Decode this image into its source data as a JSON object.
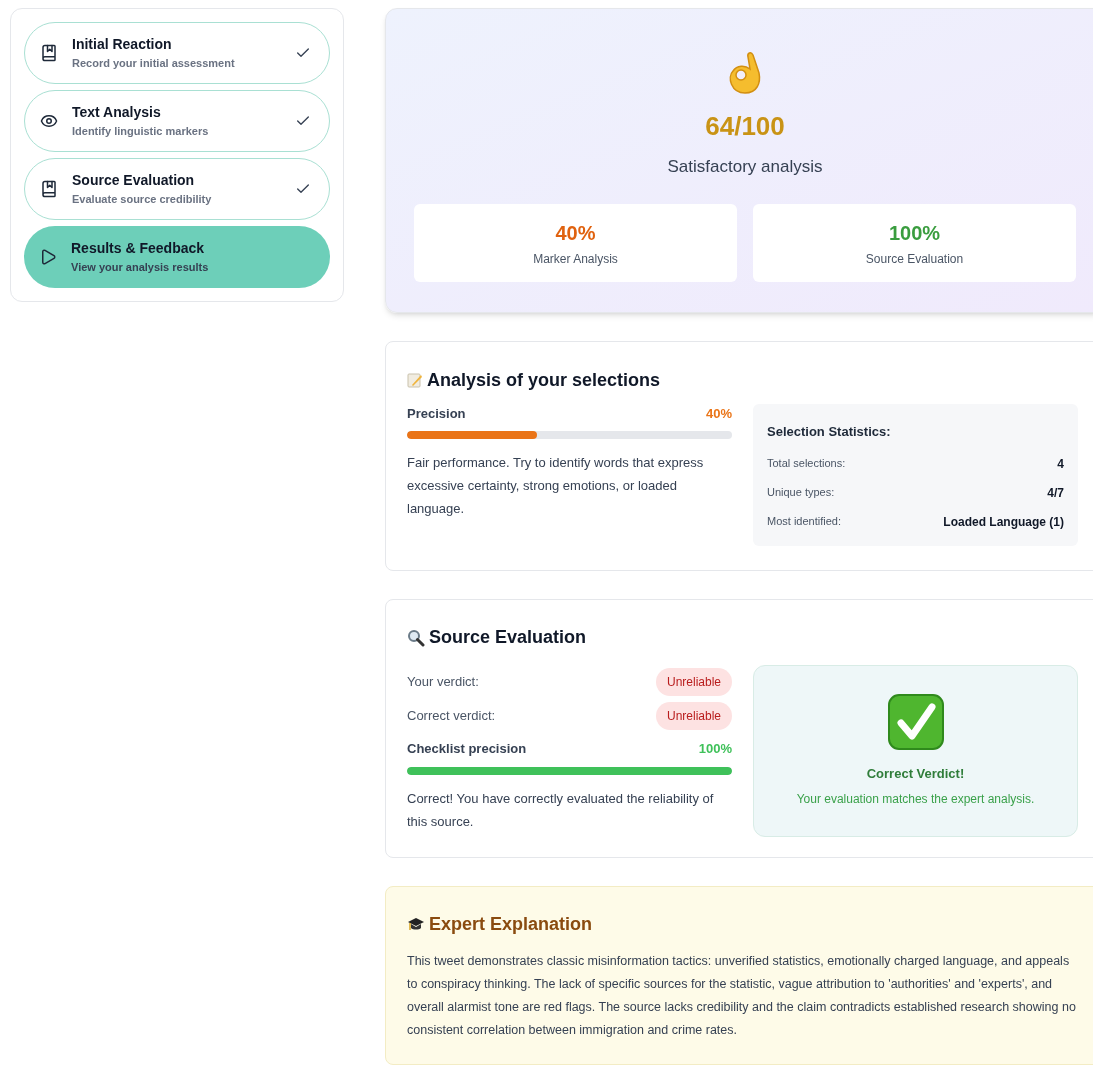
{
  "steps": [
    {
      "title": "Initial Reaction",
      "subtitle": "Record your initial assessment",
      "kind": "book",
      "completed": true,
      "selected": false
    },
    {
      "title": "Text Analysis",
      "subtitle": "Identify linguistic markers",
      "kind": "eye",
      "completed": true,
      "selected": false
    },
    {
      "title": "Source Evaluation",
      "subtitle": "Evaluate source credibility",
      "kind": "book",
      "completed": true,
      "selected": false
    },
    {
      "title": "Results & Feedback",
      "subtitle": "View your analysis results",
      "kind": "play",
      "completed": false,
      "selected": true
    }
  ],
  "score": {
    "value": "64/100",
    "label": "Satisfactory analysis",
    "metrics": [
      {
        "value": "40%",
        "label": "Marker Analysis",
        "color": "#e0620f"
      },
      {
        "value": "100%",
        "label": "Source Evaluation",
        "color": "#3a9d3f"
      }
    ]
  },
  "selections": {
    "title": "Analysis of your selections",
    "precision": {
      "label": "Precision",
      "reading": "40%",
      "level": 0.4,
      "color": "#ea7417"
    },
    "feedback": "Fair performance. Try to identify words that express excessive certainty, strong emotions, or loaded language.",
    "stats": {
      "title": "Selection Statistics:",
      "rows": [
        {
          "label": "Total selections:",
          "value": "4"
        },
        {
          "label": "Unique types:",
          "value": "4/7"
        },
        {
          "label": "Most identified:",
          "value": "Loaded Language (1)"
        }
      ]
    }
  },
  "source": {
    "title": "Source Evaluation",
    "verdicts": [
      {
        "label": "Your verdict:",
        "value": "Unreliable"
      },
      {
        "label": "Correct verdict:",
        "value": "Unreliable"
      }
    ],
    "checklist": {
      "label": "Checklist precision",
      "reading": "100%",
      "level": 1,
      "color": "#3fc15a"
    },
    "feedback": "Correct! You have correctly evaluated the reliability of this source.",
    "result": {
      "correct": true,
      "title": "Correct Verdict!",
      "text": "Your evaluation matches the expert analysis."
    }
  },
  "expert": {
    "title": "Expert Explanation",
    "text": "This tweet demonstrates classic misinformation tactics: unverified statistics, emotionally charged language, and appeals to conspiracy thinking. The lack of specific sources for the statistic, vague attribution to 'authorities' and 'experts', and overall alarmist tone are red flags. The source lacks credibility and the claim contradicts established research showing no consistent correlation between immigration and crime rates."
  }
}
